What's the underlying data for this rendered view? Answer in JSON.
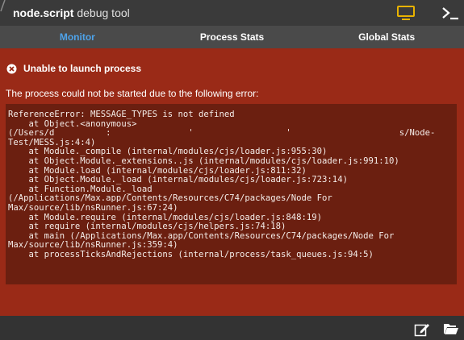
{
  "window": {
    "app_name": "node.script",
    "subtitle": "debug tool",
    "icons": [
      "monitor-icon",
      "terminal-icon"
    ]
  },
  "tabs": [
    {
      "label": "Monitor",
      "active": true
    },
    {
      "label": "Process Stats",
      "active": false
    },
    {
      "label": "Global Stats",
      "active": false
    }
  ],
  "error": {
    "icon": "error-circle-x-icon",
    "title": "Unable to launch process",
    "description": "The process could not be started due to the following error:",
    "stack": [
      "ReferenceError: MESSAGE_TYPES is not defined",
      "    at Object.<anonymous>",
      "(/Users/d          :               '                  '                     s/Node-",
      "Test/MESS.js:4:4)",
      "    at Module._compile (internal/modules/cjs/loader.js:955:30)",
      "    at Object.Module._extensions..js (internal/modules/cjs/loader.js:991:10)",
      "    at Module.load (internal/modules/cjs/loader.js:811:32)",
      "    at Object.Module._load (internal/modules/cjs/loader.js:723:14)",
      "    at Function.Module._load",
      "(/Applications/Max.app/Contents/Resources/C74/packages/Node For",
      "Max/source/lib/nsRunner.js:67:24)",
      "    at Module.require (internal/modules/cjs/loader.js:848:19)",
      "    at require (internal/modules/cjs/helpers.js:74:18)",
      "    at main (/Applications/Max.app/Contents/Resources/C74/packages/Node For",
      "Max/source/lib/nsRunner.js:359:4)",
      "    at processTicksAndRejections (internal/process/task_queues.js:94:5)"
    ]
  },
  "footer": {
    "icons": [
      "edit-icon",
      "folder-open-icon"
    ]
  },
  "colors": {
    "accent_tab": "#4ea3ea",
    "error_panel": "#9a2a17",
    "stack_box": "#6b1f10",
    "monitor_icon": "#e8b200"
  }
}
